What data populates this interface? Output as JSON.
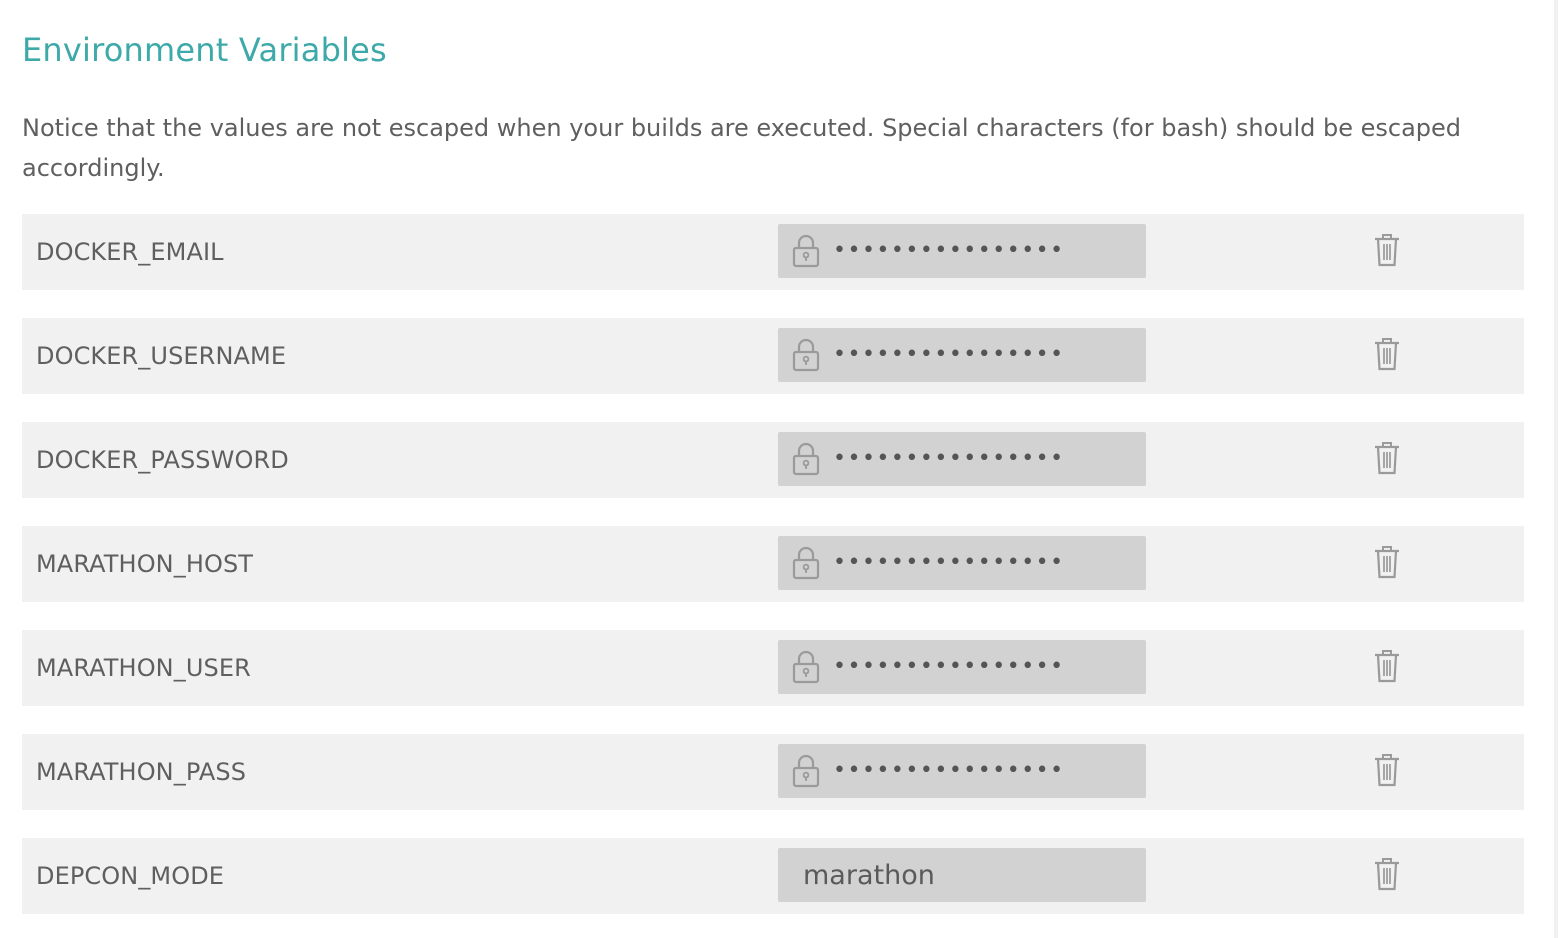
{
  "section": {
    "title": "Environment Variables",
    "notice": "Notice that the values are not escaped when your builds are executed. Special characters (for bash) should be escaped accordingly."
  },
  "env_vars": [
    {
      "name": "DOCKER_EMAIL",
      "value": "••••••••••••••••",
      "secret": true
    },
    {
      "name": "DOCKER_USERNAME",
      "value": "••••••••••••••••",
      "secret": true
    },
    {
      "name": "DOCKER_PASSWORD",
      "value": "••••••••••••••••",
      "secret": true
    },
    {
      "name": "MARATHON_HOST",
      "value": "••••••••••••••••",
      "secret": true
    },
    {
      "name": "MARATHON_USER",
      "value": "••••••••••••••••",
      "secret": true
    },
    {
      "name": "MARATHON_PASS",
      "value": "••••••••••••••••",
      "secret": true
    },
    {
      "name": "DEPCON_MODE",
      "value": "marathon",
      "secret": false
    }
  ],
  "colors": {
    "accent": "#3ea9a9",
    "row_background": "#f1f1f1",
    "value_background": "#d2d2d2",
    "text": "#5f5f5f",
    "icon": "#9a9a9a"
  },
  "icons": {
    "secret": "lock-icon",
    "delete": "trash-icon"
  }
}
